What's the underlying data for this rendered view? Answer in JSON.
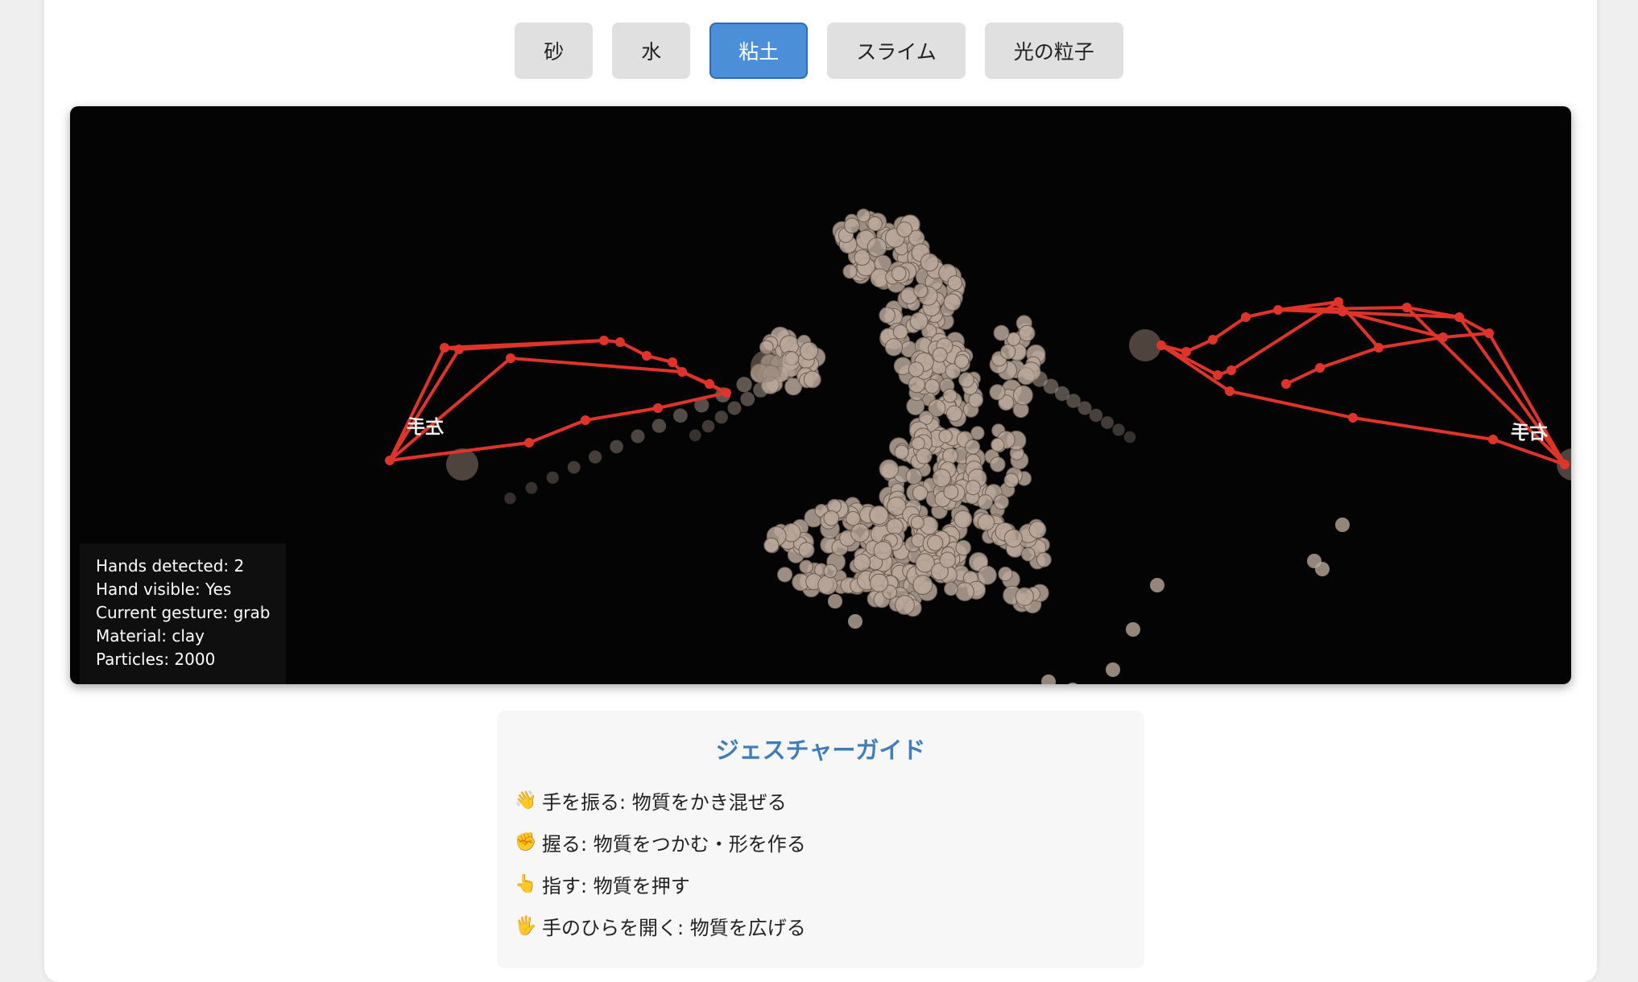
{
  "materials": {
    "buttons": [
      {
        "label": "砂",
        "active": false
      },
      {
        "label": "水",
        "active": false
      },
      {
        "label": "粘土",
        "active": true
      },
      {
        "label": "スライム",
        "active": false
      },
      {
        "label": "光の粒子",
        "active": false
      }
    ]
  },
  "canvas": {
    "hand_labels": {
      "left": "左手",
      "right": "右手"
    },
    "landmark_color": "#e0342a",
    "particle_color": "#b8a79a",
    "background_color": "#050404"
  },
  "stats": {
    "hands": "Hands detected: 2",
    "visible": "Hand visible: Yes",
    "gesture": "Current gesture: grab",
    "material": "Material: clay",
    "particles": "Particles: 2000"
  },
  "guide": {
    "title": "ジェスチャーガイド",
    "items": [
      {
        "icon": "👋",
        "icon_name": "waving-hand-icon",
        "text": "手を振る: 物質をかき混ぜる"
      },
      {
        "icon": "✊",
        "icon_name": "fist-icon",
        "text": "握る: 物質をつかむ・形を作る"
      },
      {
        "icon": "👆",
        "icon_name": "pointing-finger-icon",
        "text": "指す: 物質を押す"
      },
      {
        "icon": "🖐",
        "icon_name": "open-palm-icon",
        "text": "手のひらを開く: 物質を広げる"
      }
    ]
  }
}
